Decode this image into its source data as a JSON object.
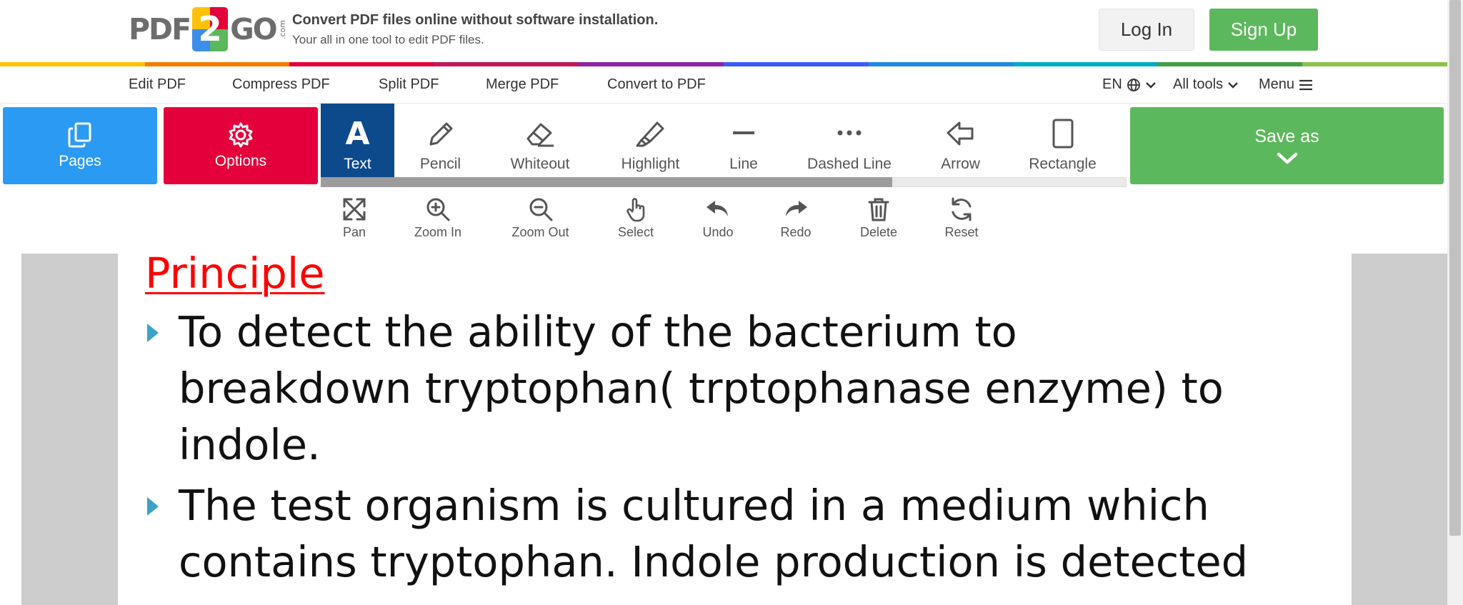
{
  "header": {
    "logo": {
      "left": "PDF",
      "middle": "2",
      "right": "GO",
      "suffix": ".com"
    },
    "tagline_title": "Convert PDF files online without software installation.",
    "tagline_subtitle": "Your all in one tool to edit PDF files.",
    "login_label": "Log In",
    "signup_label": "Sign Up"
  },
  "colors": {
    "brand_blue": "#2b9af3",
    "brand_red": "#e4003a",
    "brand_green": "#5cb85c",
    "active_tool": "#0c4a8c",
    "bar": [
      "#ffc107",
      "#f57c00",
      "#e4003a",
      "#c2185b",
      "#8e24aa",
      "#3d5afe",
      "#1e88e5",
      "#00acc1",
      "#43a047",
      "#8bc34a"
    ]
  },
  "nav": {
    "items": [
      "Edit PDF",
      "Compress PDF",
      "Split PDF",
      "Merge PDF",
      "Convert to PDF"
    ],
    "language": "EN",
    "all_tools": "All tools",
    "menu": "Menu"
  },
  "toolbar": {
    "pages_label": "Pages",
    "options_label": "Options",
    "save_as_label": "Save as",
    "tools": [
      {
        "label": "Text",
        "icon": "text-icon",
        "active": true
      },
      {
        "label": "Pencil",
        "icon": "pencil-icon"
      },
      {
        "label": "Whiteout",
        "icon": "eraser-icon"
      },
      {
        "label": "Highlight",
        "icon": "highlighter-icon"
      },
      {
        "label": "Line",
        "icon": "line-icon"
      },
      {
        "label": "Dashed Line",
        "icon": "dashed-line-icon"
      },
      {
        "label": "Arrow",
        "icon": "arrow-icon"
      },
      {
        "label": "Rectangle",
        "icon": "rectangle-icon"
      }
    ],
    "sub_tools": [
      "Pan",
      "Zoom In",
      "Zoom Out",
      "Select",
      "Undo",
      "Redo",
      "Delete",
      "Reset"
    ]
  },
  "document": {
    "title": "Principle",
    "bullets": [
      [
        " To detect the ability of the bacterium to",
        "breakdown tryptophan( trptophanase enzyme) to",
        "indole."
      ],
      [
        "The test organism is cultured in a medium which",
        "contains tryptophan. Indole production is detected"
      ]
    ]
  }
}
